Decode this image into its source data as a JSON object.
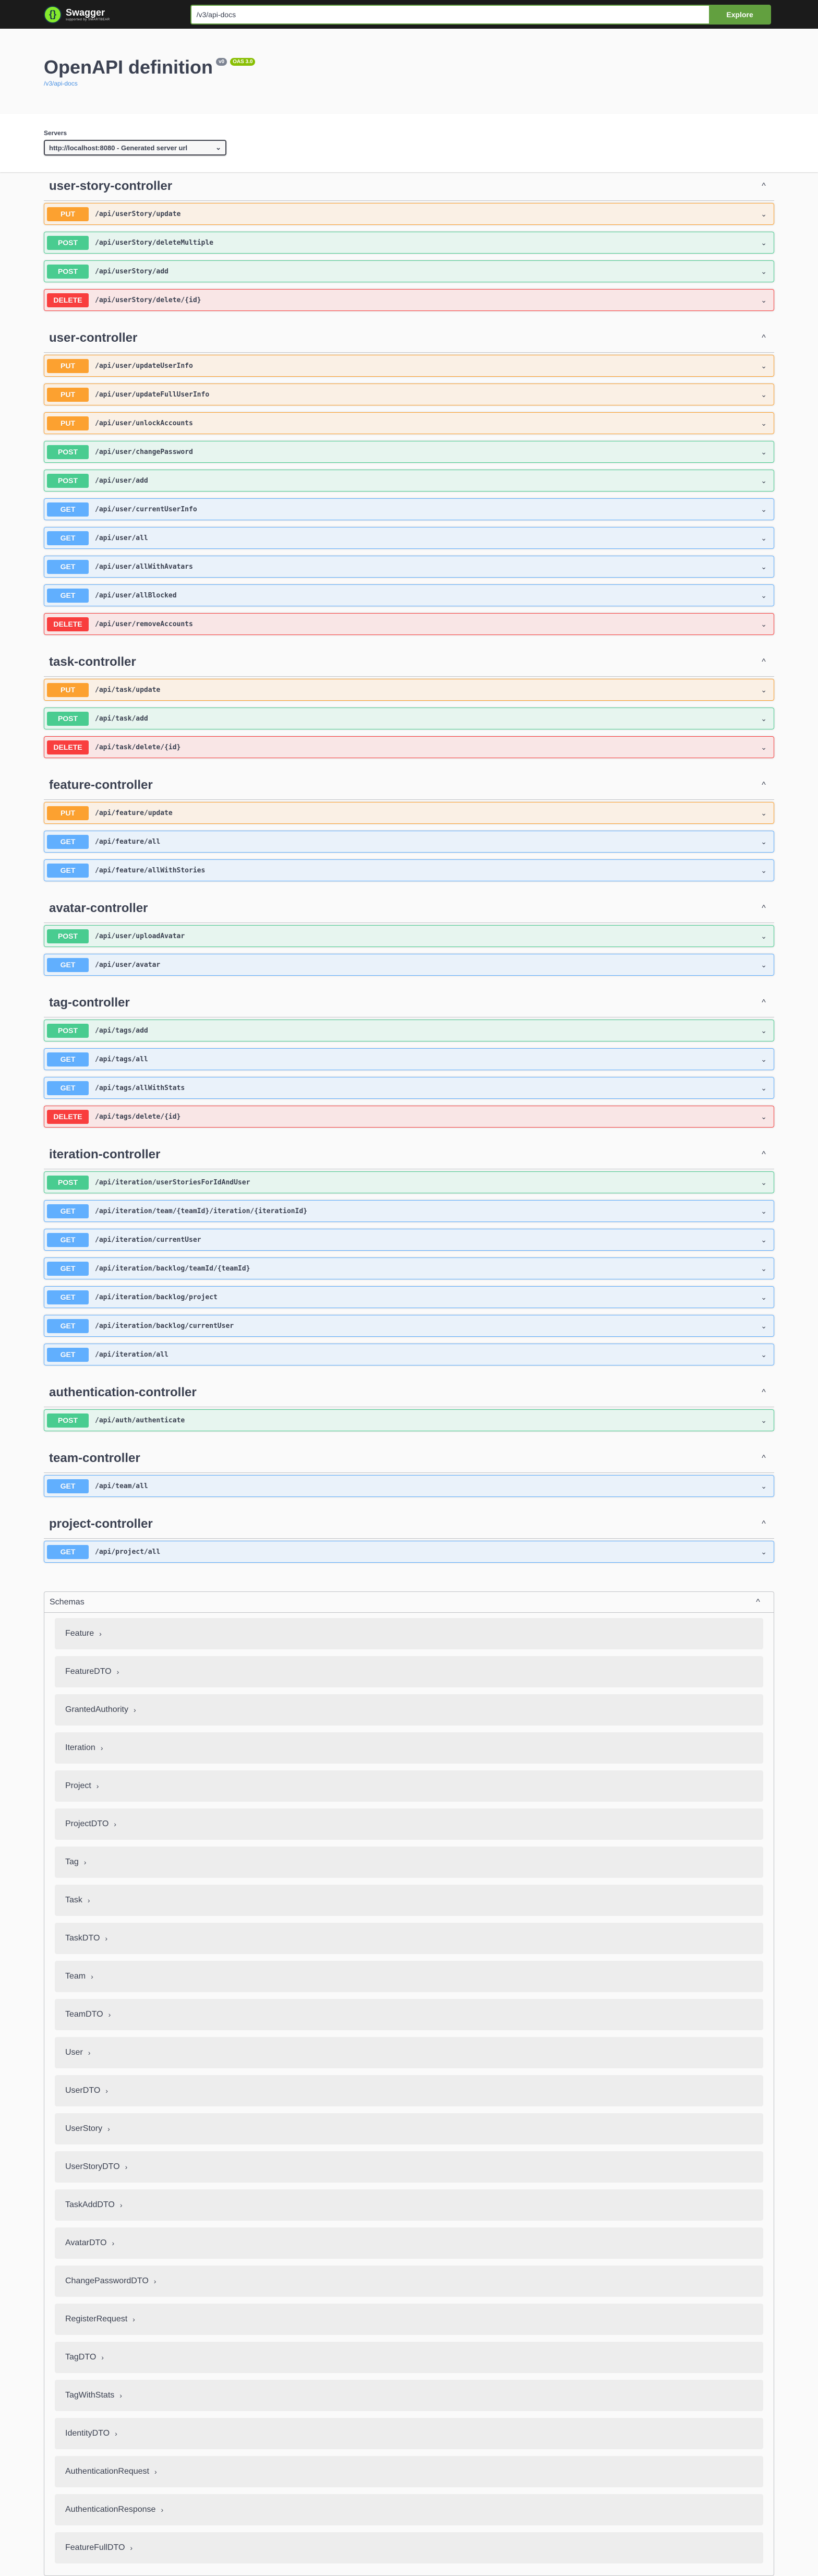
{
  "topbar": {
    "logo_name": "Swagger",
    "logo_by": "supported by SMARTBEAR",
    "search_value": "/v3/api-docs",
    "explore_label": "Explore"
  },
  "info": {
    "title": "OpenAPI definition",
    "version": "v0",
    "oas": "OAS 3.0",
    "link": "/v3/api-docs"
  },
  "servers": {
    "label": "Servers",
    "selected": "http://localhost:8080 - Generated server url"
  },
  "tags": [
    {
      "name": "user-story-controller",
      "ops": [
        {
          "method": "PUT",
          "path": "/api/userStory/update"
        },
        {
          "method": "POST",
          "path": "/api/userStory/deleteMultiple"
        },
        {
          "method": "POST",
          "path": "/api/userStory/add"
        },
        {
          "method": "DELETE",
          "path": "/api/userStory/delete/{id}"
        }
      ]
    },
    {
      "name": "user-controller",
      "ops": [
        {
          "method": "PUT",
          "path": "/api/user/updateUserInfo"
        },
        {
          "method": "PUT",
          "path": "/api/user/updateFullUserInfo"
        },
        {
          "method": "PUT",
          "path": "/api/user/unlockAccounts"
        },
        {
          "method": "POST",
          "path": "/api/user/changePassword"
        },
        {
          "method": "POST",
          "path": "/api/user/add"
        },
        {
          "method": "GET",
          "path": "/api/user/currentUserInfo"
        },
        {
          "method": "GET",
          "path": "/api/user/all"
        },
        {
          "method": "GET",
          "path": "/api/user/allWithAvatars"
        },
        {
          "method": "GET",
          "path": "/api/user/allBlocked"
        },
        {
          "method": "DELETE",
          "path": "/api/user/removeAccounts"
        }
      ]
    },
    {
      "name": "task-controller",
      "ops": [
        {
          "method": "PUT",
          "path": "/api/task/update"
        },
        {
          "method": "POST",
          "path": "/api/task/add"
        },
        {
          "method": "DELETE",
          "path": "/api/task/delete/{id}"
        }
      ]
    },
    {
      "name": "feature-controller",
      "ops": [
        {
          "method": "PUT",
          "path": "/api/feature/update"
        },
        {
          "method": "GET",
          "path": "/api/feature/all"
        },
        {
          "method": "GET",
          "path": "/api/feature/allWithStories"
        }
      ]
    },
    {
      "name": "avatar-controller",
      "ops": [
        {
          "method": "POST",
          "path": "/api/user/uploadAvatar"
        },
        {
          "method": "GET",
          "path": "/api/user/avatar"
        }
      ]
    },
    {
      "name": "tag-controller",
      "ops": [
        {
          "method": "POST",
          "path": "/api/tags/add"
        },
        {
          "method": "GET",
          "path": "/api/tags/all"
        },
        {
          "method": "GET",
          "path": "/api/tags/allWithStats"
        },
        {
          "method": "DELETE",
          "path": "/api/tags/delete/{id}"
        }
      ]
    },
    {
      "name": "iteration-controller",
      "ops": [
        {
          "method": "POST",
          "path": "/api/iteration/userStoriesForIdAndUser"
        },
        {
          "method": "GET",
          "path": "/api/iteration/team/{teamId}/iteration/{iterationId}"
        },
        {
          "method": "GET",
          "path": "/api/iteration/currentUser"
        },
        {
          "method": "GET",
          "path": "/api/iteration/backlog/teamId/{teamId}"
        },
        {
          "method": "GET",
          "path": "/api/iteration/backlog/project"
        },
        {
          "method": "GET",
          "path": "/api/iteration/backlog/currentUser"
        },
        {
          "method": "GET",
          "path": "/api/iteration/all"
        }
      ]
    },
    {
      "name": "authentication-controller",
      "ops": [
        {
          "method": "POST",
          "path": "/api/auth/authenticate"
        }
      ]
    },
    {
      "name": "team-controller",
      "ops": [
        {
          "method": "GET",
          "path": "/api/team/all"
        }
      ]
    },
    {
      "name": "project-controller",
      "ops": [
        {
          "method": "GET",
          "path": "/api/project/all"
        }
      ]
    }
  ],
  "schemas": {
    "title": "Schemas",
    "items": [
      "Feature",
      "FeatureDTO",
      "GrantedAuthority",
      "Iteration",
      "Project",
      "ProjectDTO",
      "Tag",
      "Task",
      "TaskDTO",
      "Team",
      "TeamDTO",
      "User",
      "UserDTO",
      "UserStory",
      "UserStoryDTO",
      "TaskAddDTO",
      "AvatarDTO",
      "ChangePasswordDTO",
      "RegisterRequest",
      "TagDTO",
      "TagWithStats",
      "IdentityDTO",
      "AuthenticationRequest",
      "AuthenticationResponse",
      "FeatureFullDTO"
    ]
  }
}
